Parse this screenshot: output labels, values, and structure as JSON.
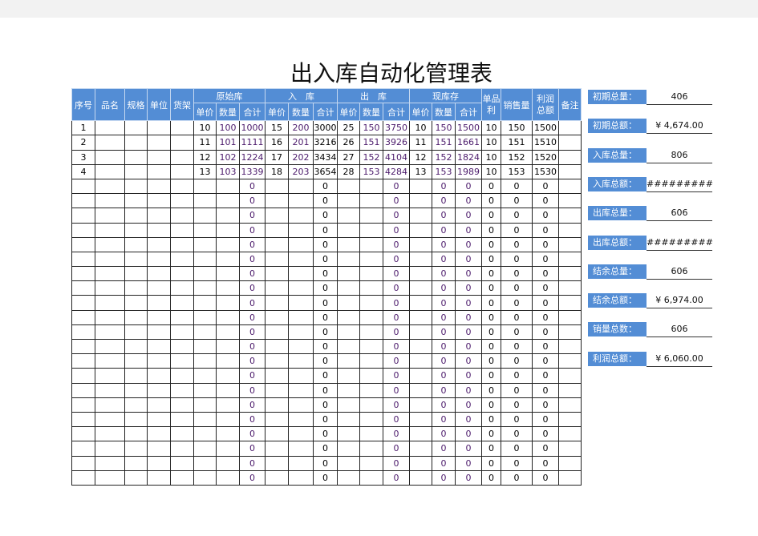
{
  "title": "出入库自动化管理表",
  "headers": {
    "seq": "序号",
    "name": "品名",
    "spec": "规格",
    "unit": "单位",
    "shelf": "货架",
    "orig": "原始库",
    "in": "入　库",
    "out": "出　库",
    "stock": "现库存",
    "unit_profit": "单品利",
    "sales": "销售量",
    "profit": "利润总额",
    "note": "备注",
    "price": "单价",
    "qty": "数量",
    "total": "合计"
  },
  "rows": [
    [
      "1",
      "",
      "",
      "",
      "",
      "10",
      "100",
      "1000",
      "15",
      "200",
      "3000",
      "25",
      "150",
      "3750",
      "10",
      "150",
      "1500",
      "10",
      "150",
      "1500",
      ""
    ],
    [
      "2",
      "",
      "",
      "",
      "",
      "11",
      "101",
      "1111",
      "16",
      "201",
      "3216",
      "26",
      "151",
      "3926",
      "11",
      "151",
      "1661",
      "10",
      "151",
      "1510",
      ""
    ],
    [
      "3",
      "",
      "",
      "",
      "",
      "12",
      "102",
      "1224",
      "17",
      "202",
      "3434",
      "27",
      "152",
      "4104",
      "12",
      "152",
      "1824",
      "10",
      "152",
      "1520",
      ""
    ],
    [
      "4",
      "",
      "",
      "",
      "",
      "13",
      "103",
      "1339",
      "18",
      "203",
      "3654",
      "28",
      "153",
      "4284",
      "13",
      "153",
      "1989",
      "10",
      "153",
      "1530",
      ""
    ]
  ],
  "empty_row": [
    "",
    "",
    "",
    "",
    "",
    "",
    "",
    "0",
    "",
    "",
    "0",
    "",
    "",
    "0",
    "",
    "0",
    "0",
    "0",
    "0",
    "0",
    ""
  ],
  "empty_row_count": 21,
  "summary": [
    {
      "label": "初期总量：",
      "value": "406"
    },
    {
      "label": "初期总额：",
      "value": "¥  4,674.00"
    },
    {
      "label": "入库总量：",
      "value": "806"
    },
    {
      "label": "入库总额：",
      "value": "#########"
    },
    {
      "label": "出库总量：",
      "value": "606"
    },
    {
      "label": "出库总额：",
      "value": "#########"
    },
    {
      "label": "结余总量：",
      "value": "606"
    },
    {
      "label": "结余总额：",
      "value": "¥  6,974.00"
    },
    {
      "label": "销量总数：",
      "value": "606"
    },
    {
      "label": "利润总额：",
      "value": "¥  6,060.00"
    }
  ],
  "colors": {
    "header": "#538dd5",
    "qty_text": "#4b1a6b"
  }
}
